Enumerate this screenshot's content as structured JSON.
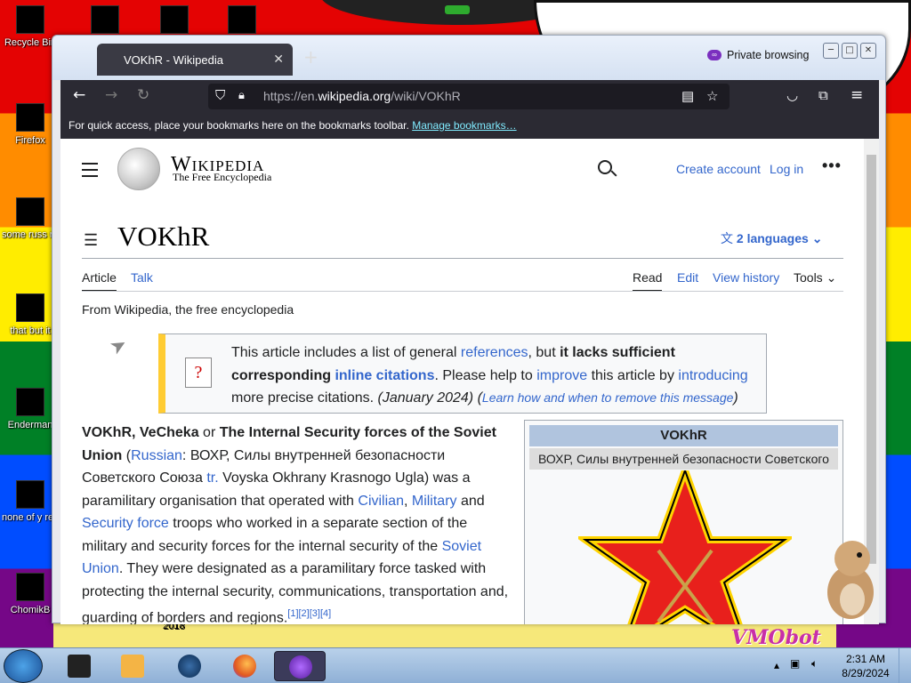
{
  "desktop": {
    "icons": [
      {
        "label": "Recycle Bin"
      },
      {
        "label": "Firefox"
      },
      {
        "label": "some russ ran a ra"
      },
      {
        "label": "that but it"
      },
      {
        "label": "Enderman"
      },
      {
        "label": "none of y retards kn"
      },
      {
        "label": "ChomikB"
      }
    ],
    "year_stamp": "2018",
    "watermark": "VMObot"
  },
  "browser": {
    "tab_title": "VOKhR - Wikipedia",
    "tab_close": "✕",
    "new_tab": "+",
    "private_label": "Private browsing",
    "url_prefix": "https://en.",
    "url_host": "wikipedia.org",
    "url_path": "/wiki/VOKhR",
    "bookmarks_text": "For quick access, place your bookmarks here on the bookmarks toolbar.",
    "bookmarks_link": "Manage bookmarks…"
  },
  "wiki": {
    "wordmark": "Wikipedia",
    "tagline": "The Free Encyclopedia",
    "create_account": "Create account",
    "log_in": "Log in",
    "title": "VOKhR",
    "languages": "2 languages",
    "tabs": {
      "article": "Article",
      "talk": "Talk",
      "read": "Read",
      "edit": "Edit",
      "history": "View history",
      "tools": "Tools"
    },
    "from": "From Wikipedia, the free encyclopedia",
    "ambox": {
      "p1": "This article includes a list of general ",
      "l1": "references",
      "p2": ", but ",
      "b1": "it lacks sufficient corresponding ",
      "l2": "inline citations",
      "p3": ". Please help to ",
      "l3": "improve",
      "p4": " this article by ",
      "l4": "introducing",
      "p5": " more precise citations. ",
      "date": "(January 2024)",
      "p6": " (",
      "l5": "Learn how and when to remove this message",
      "p7": ")"
    },
    "lead": {
      "b1": "VOKhR, VeCheka",
      "t1": " or ",
      "b2": "The Internal Security forces of the Soviet Union",
      "t2": " (",
      "l1": "Russian",
      "t3": ": ВОХР, Силы внутренней безопасности Советского Союза ",
      "l2": "tr.",
      "t4": " Voyska Okhrany Krasnogo Ugla) was a paramilitary organisation that operated with ",
      "l3": "Civilian",
      "t5": ", ",
      "l4": "Military",
      "t6": " and ",
      "l5": "Security force",
      "t7": " troops who worked in a separate section of the military and security forces for the internal security of the ",
      "l6": "Soviet Union",
      "t8": ". They were designated as a paramilitary force tasked with protecting the internal security, communications, transportation and, guarding of borders and regions.",
      "refs": "[1][2][3][4]"
    },
    "infobox": {
      "header": "VOKhR",
      "subtitle": "ВОХР, Силы внутренней безопасности Советского"
    }
  },
  "taskbar": {
    "time": "2:31 AM",
    "date": "8/29/2024"
  }
}
